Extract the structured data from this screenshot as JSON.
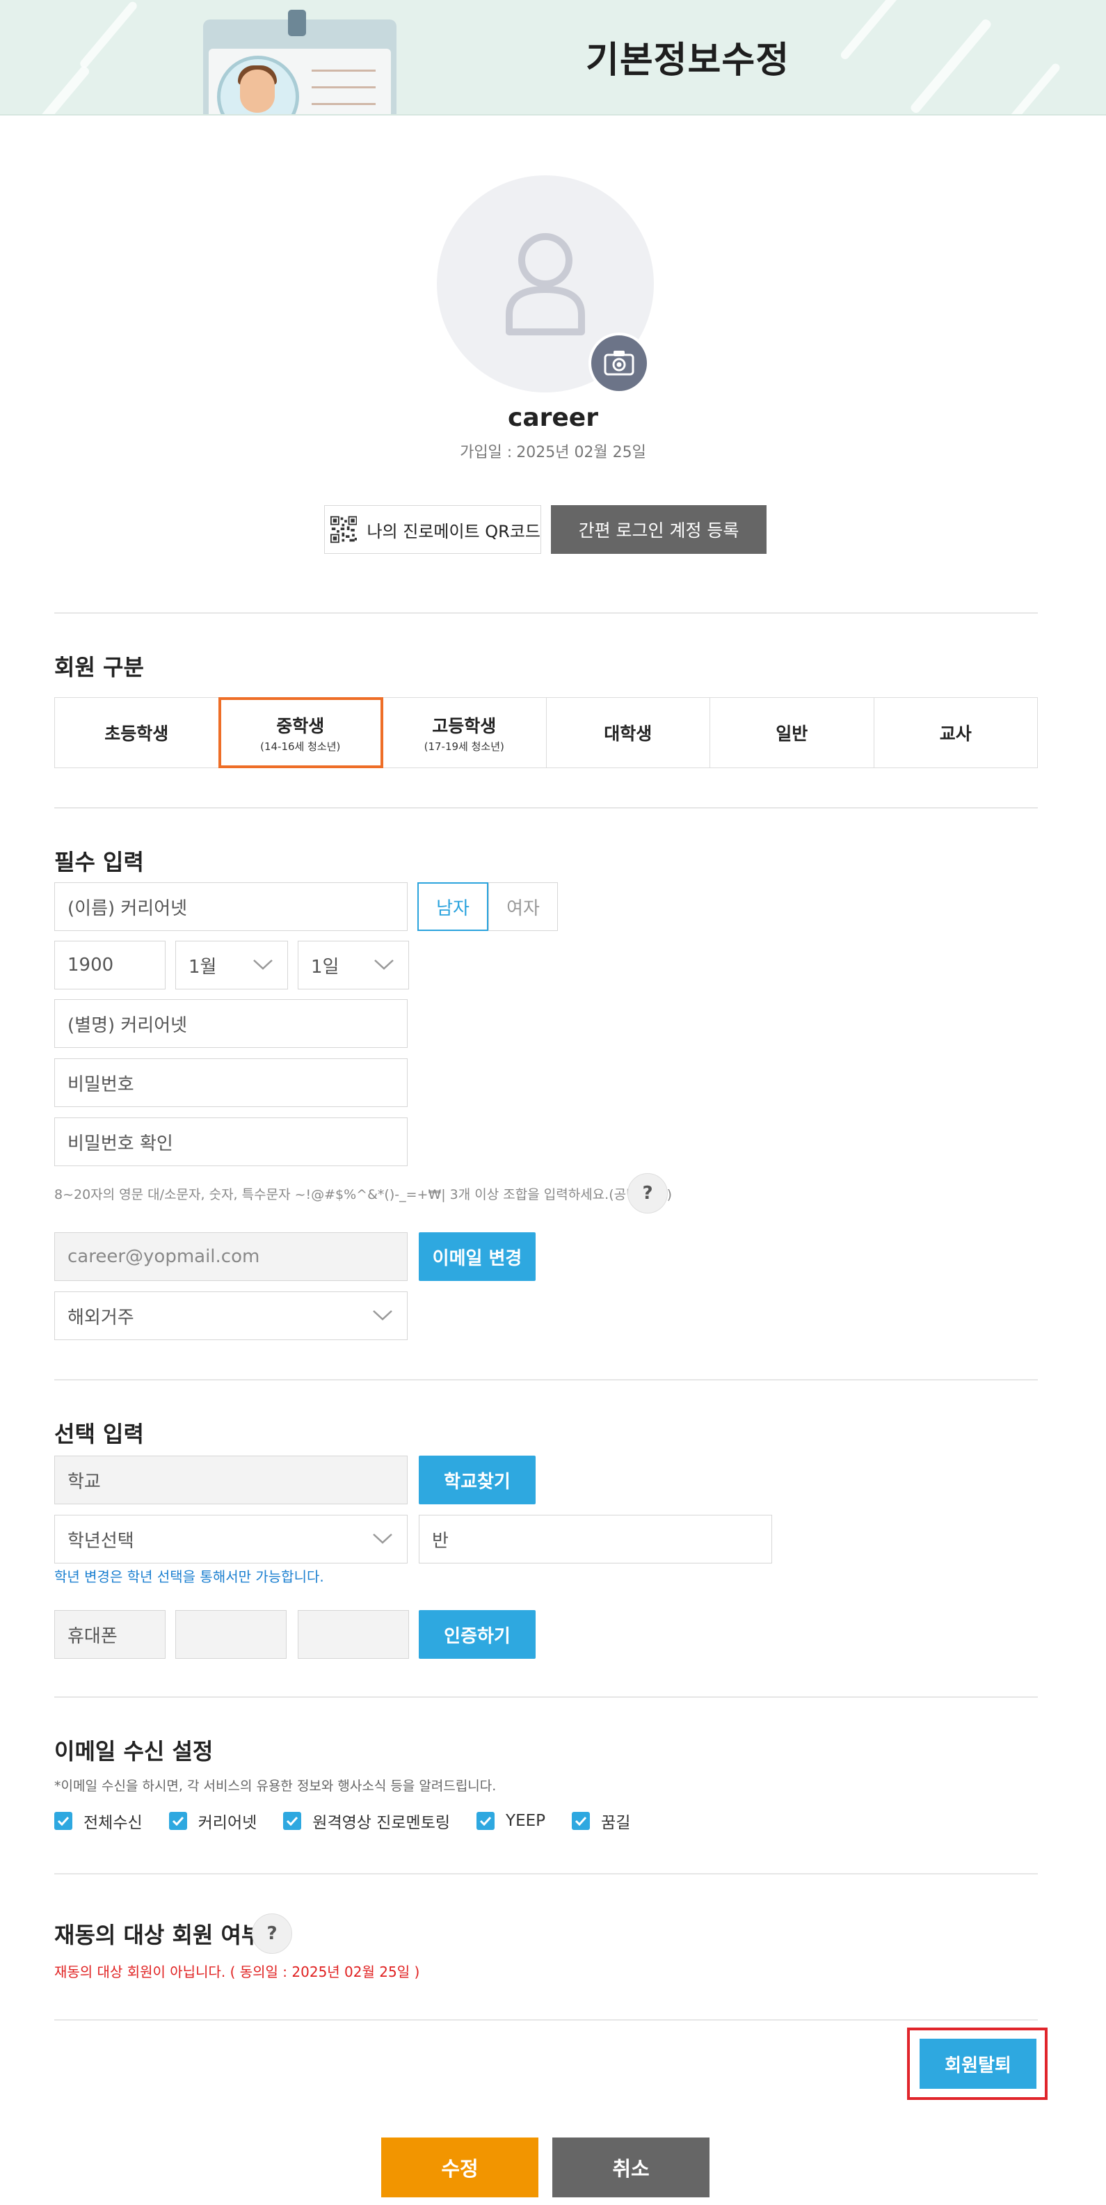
{
  "header": {
    "title": "기본정보수정"
  },
  "profile": {
    "username": "career",
    "join_label": "가입일 :",
    "join_date": "2025년 02월 25일",
    "qr_label": "나의 진로메이트 QR코드",
    "simple_login_label": "간편 로그인 계정 등록"
  },
  "member_type": {
    "title": "회원 구분",
    "tabs": [
      {
        "label": "초등학생",
        "sub": ""
      },
      {
        "label": "중학생",
        "sub": "(14-16세 청소년)"
      },
      {
        "label": "고등학생",
        "sub": "(17-19세 청소년)"
      },
      {
        "label": "대학생",
        "sub": ""
      },
      {
        "label": "일반",
        "sub": ""
      },
      {
        "label": "교사",
        "sub": ""
      }
    ],
    "selected": "중학생"
  },
  "required": {
    "title": "필수 입력",
    "name_value": "(이름) 커리어넷",
    "gender_male": "남자",
    "gender_female": "여자",
    "gender_selected": "남자",
    "birth_year": "1900",
    "birth_month": "1월",
    "birth_day": "1일",
    "nickname_value": "(별명) 커리어넷",
    "password_placeholder": "비밀번호",
    "password_confirm_placeholder": "비밀번호 확인",
    "password_hint": "8~20자의 영문 대/소문자, 숫자, 특수문자 ~!@#$%^&*()-_=+₩| 3개 이상 조합을 입력하세요.(공백 불가)",
    "help_mark": "?",
    "email_value": "career@yopmail.com",
    "email_change_label": "이메일 변경",
    "region_value": "해외거주"
  },
  "optional": {
    "title": "선택 입력",
    "school_placeholder": "학교",
    "school_find_label": "학교찾기",
    "grade_select": "학년선택",
    "class_placeholder": "반",
    "grade_note": "학년 변경은 학년 선택을 통해서만 가능합니다.",
    "phone_prefix": "휴대폰",
    "phone_mid": "",
    "phone_last": "",
    "verify_label": "인증하기"
  },
  "email_receive": {
    "title": "이메일 수신 설정",
    "desc": "*이메일 수신을 하시면, 각 서비스의 유용한 정보와 행사소식 등을 알려드립니다.",
    "options": [
      {
        "label": "전체수신",
        "checked": true
      },
      {
        "label": "커리어넷",
        "checked": true
      },
      {
        "label": "원격영상 진로멘토링",
        "checked": true
      },
      {
        "label": "YEEP",
        "checked": true
      },
      {
        "label": "꿈길",
        "checked": true
      }
    ]
  },
  "reuse": {
    "title": "재동의 대상 회원 여부",
    "help_mark": "?",
    "note": "재동의 대상 회원이 아닙니다. ( 동의일 : 2025년 02월 25일 )"
  },
  "actions": {
    "withdraw_label": "회원탈퇴",
    "submit_label": "수정",
    "cancel_label": "취소"
  },
  "colors": {
    "accent_blue": "#2ea8e0",
    "submit_orange": "#f29500",
    "selected_tab_border": "#ee6e27",
    "highlight_red": "#e0252b",
    "header_bg": "#e4f1ec"
  }
}
